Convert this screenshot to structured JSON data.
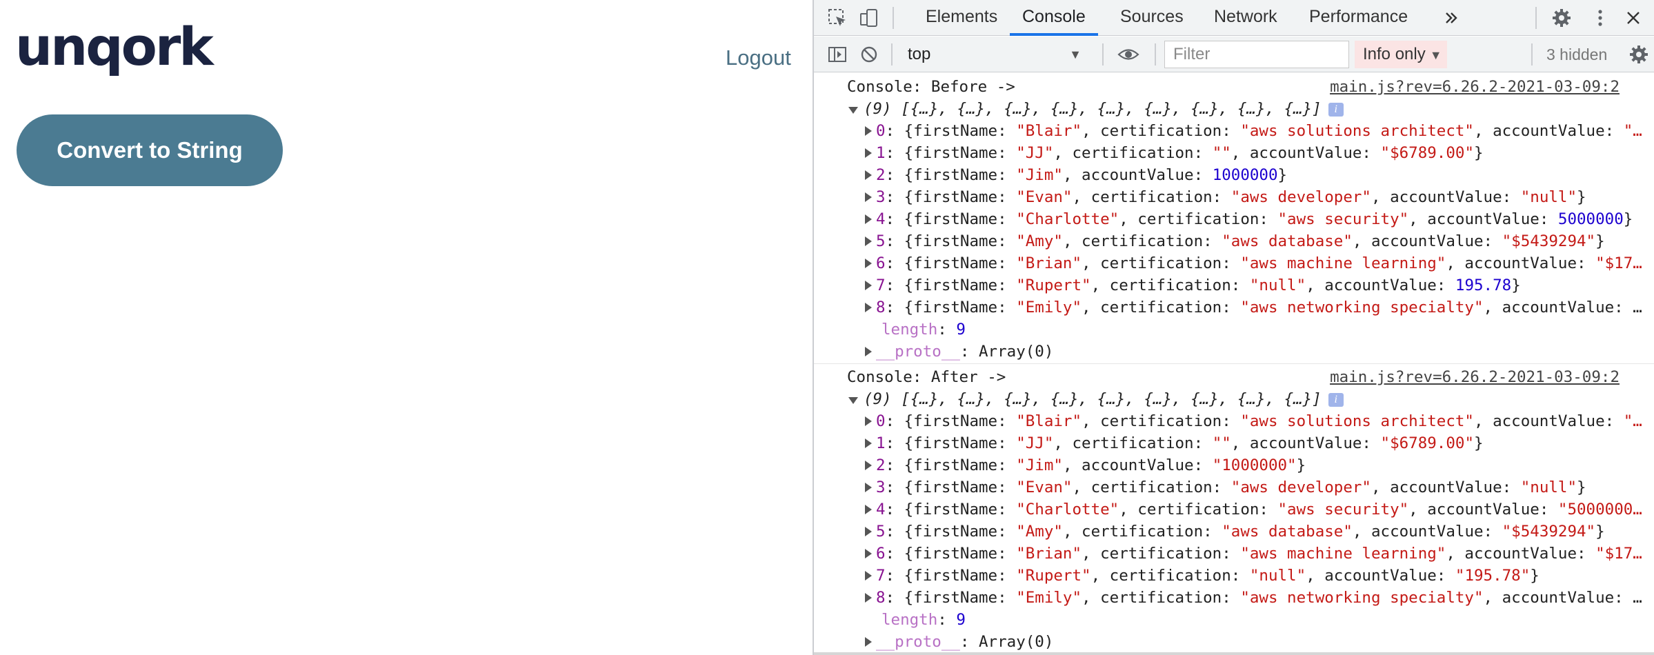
{
  "app": {
    "logo": "unqork",
    "logout_label": "Logout",
    "convert_button_label": "Convert to String",
    "colors": {
      "logo": "#1b2340",
      "button": "#4b7b92",
      "logout": "#4a6f83"
    }
  },
  "devtools": {
    "tabs": [
      "Elements",
      "Console",
      "Sources",
      "Network",
      "Performance"
    ],
    "active_tab": "Console",
    "more_tabs_icon": "chevrons-right-icon",
    "toolbar": {
      "context": "top",
      "filter_placeholder": "Filter",
      "levels": "Info only",
      "hidden_count": "3 hidden"
    },
    "console": {
      "groups": [
        {
          "label": "Console: Before ->",
          "source": "main.js?rev=6.26.2-2021-03-09:2",
          "array_head": "(9) [{…}, {…}, {…}, {…}, {…}, {…}, {…}, {…}, {…}]",
          "items": [
            {
              "idx": "0",
              "name": "\"Blair\"",
              "cert": "\"aws solutions architect\"",
              "value": "\"…",
              "value_type": "str",
              "truncated": true
            },
            {
              "idx": "1",
              "name": "\"JJ\"",
              "cert": "\"\"",
              "value": "\"$6789.00\"",
              "value_type": "str",
              "truncated": false
            },
            {
              "idx": "2",
              "name": "\"Jim\"",
              "cert": null,
              "value": "1000000",
              "value_type": "num",
              "truncated": false
            },
            {
              "idx": "3",
              "name": "\"Evan\"",
              "cert": "\"aws developer\"",
              "value": "\"null\"",
              "value_type": "str",
              "truncated": false
            },
            {
              "idx": "4",
              "name": "\"Charlotte\"",
              "cert": "\"aws security\"",
              "value": "5000000",
              "value_type": "num",
              "truncated": false
            },
            {
              "idx": "5",
              "name": "\"Amy\"",
              "cert": "\"aws database\"",
              "value": "\"$5439294\"",
              "value_type": "str",
              "truncated": false
            },
            {
              "idx": "6",
              "name": "\"Brian\"",
              "cert": "\"aws machine learning\"",
              "value": "\"$17…",
              "value_type": "str",
              "truncated": true
            },
            {
              "idx": "7",
              "name": "\"Rupert\"",
              "cert": "\"null\"",
              "value": "195.78",
              "value_type": "num",
              "truncated": false
            },
            {
              "idx": "8",
              "name": "\"Emily\"",
              "cert": "\"aws networking specialty\"",
              "value": "…",
              "value_type": "plain",
              "truncated": true
            }
          ],
          "length_label": "length",
          "length_value": "9",
          "proto_label": "__proto__",
          "proto_value": "Array(0)"
        },
        {
          "label": "Console: After ->",
          "source": "main.js?rev=6.26.2-2021-03-09:2",
          "array_head": "(9) [{…}, {…}, {…}, {…}, {…}, {…}, {…}, {…}, {…}]",
          "items": [
            {
              "idx": "0",
              "name": "\"Blair\"",
              "cert": "\"aws solutions architect\"",
              "value": "\"…",
              "value_type": "str",
              "truncated": true
            },
            {
              "idx": "1",
              "name": "\"JJ\"",
              "cert": "\"\"",
              "value": "\"$6789.00\"",
              "value_type": "str",
              "truncated": false
            },
            {
              "idx": "2",
              "name": "\"Jim\"",
              "cert": null,
              "value": "\"1000000\"",
              "value_type": "str",
              "truncated": false
            },
            {
              "idx": "3",
              "name": "\"Evan\"",
              "cert": "\"aws developer\"",
              "value": "\"null\"",
              "value_type": "str",
              "truncated": false
            },
            {
              "idx": "4",
              "name": "\"Charlotte\"",
              "cert": "\"aws security\"",
              "value": "\"5000000…",
              "value_type": "str",
              "truncated": true
            },
            {
              "idx": "5",
              "name": "\"Amy\"",
              "cert": "\"aws database\"",
              "value": "\"$5439294\"",
              "value_type": "str",
              "truncated": false
            },
            {
              "idx": "6",
              "name": "\"Brian\"",
              "cert": "\"aws machine learning\"",
              "value": "\"$17…",
              "value_type": "str",
              "truncated": true
            },
            {
              "idx": "7",
              "name": "\"Rupert\"",
              "cert": "\"null\"",
              "value": "\"195.78\"",
              "value_type": "str",
              "truncated": false
            },
            {
              "idx": "8",
              "name": "\"Emily\"",
              "cert": "\"aws networking specialty\"",
              "value": "…",
              "value_type": "plain",
              "truncated": true
            }
          ],
          "length_label": "length",
          "length_value": "9",
          "proto_label": "__proto__",
          "proto_value": "Array(0)"
        }
      ]
    }
  }
}
